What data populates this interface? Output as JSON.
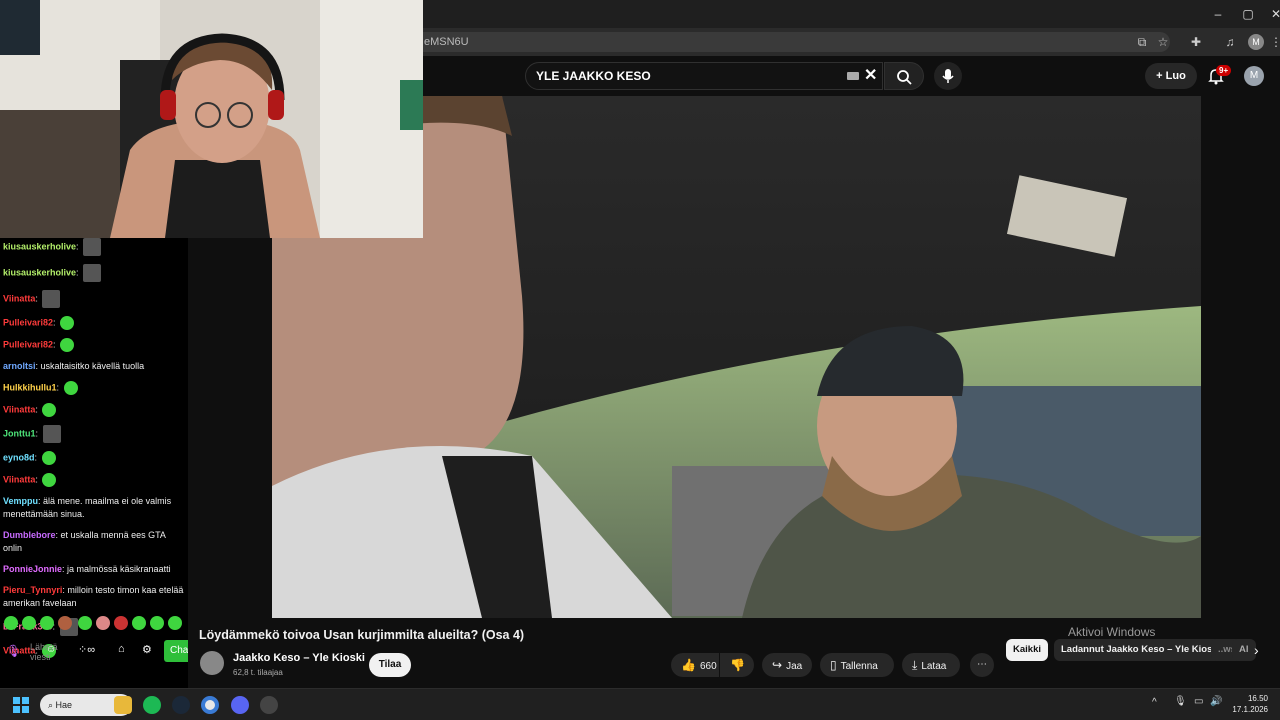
{
  "browser": {
    "url_fragment": "eMSN6U",
    "profile_initial": "M"
  },
  "youtube": {
    "search_value": "YLE JAAKKO KESO",
    "create_label": "Luo",
    "notification_badge": "9+",
    "avatar_initial": "M"
  },
  "video": {
    "title": "Löydämmekö toivoa Usan kurjimmilta alueilta? (Osa 4)",
    "channel": "Jaakko Keso – Yle Kioski",
    "subscribers": "62,8 t. tilaajaa",
    "subscribe_label": "Tilaa",
    "likes": "660",
    "share_label": "Jaa",
    "save_label": "Tallenna",
    "download_label": "Lataa"
  },
  "chips": [
    "Kaikki",
    "Ladannut Jaakko Keso – Yle Kioski",
    "..ws.",
    "Al"
  ],
  "windows_watermark": "Aktivoi Windows",
  "chat": {
    "messages": [
      {
        "user": "kiusauskerholive",
        "color": "#b4f06b",
        "text": "",
        "emote": "img"
      },
      {
        "user": "kiusauskerholive",
        "color": "#b4f06b",
        "text": "",
        "emote": "img"
      },
      {
        "user": "Viinatta",
        "color": "#ff3b3b",
        "text": "",
        "emote": "img"
      },
      {
        "user": "Pulleivari82",
        "color": "#ff3b3b",
        "text": "",
        "emote": "pepe"
      },
      {
        "user": "Pulleivari82",
        "color": "#ff3b3b",
        "text": "",
        "emote": "pepe"
      },
      {
        "user": "arnoltsi",
        "color": "#6fa8ff",
        "text": "uskaltaisitko kävellä tuolla",
        "emote": ""
      },
      {
        "user": "Hulkkihullu1",
        "color": "#ffd24a",
        "text": "",
        "emote": "pepe"
      },
      {
        "user": "Viinatta",
        "color": "#ff3b3b",
        "text": "",
        "emote": "pepe"
      },
      {
        "user": "Jonttu1",
        "color": "#4ee57a",
        "text": "",
        "emote": "img"
      },
      {
        "user": "eyno8d",
        "color": "#6fe0ff",
        "text": "",
        "emote": "pepe"
      },
      {
        "user": "Viinatta",
        "color": "#ff3b3b",
        "text": "",
        "emote": "pepe"
      },
      {
        "user": "Vemppu",
        "color": "#6fe0ff",
        "text": "älä mene. maailma ei ole valmis menettämään sinua.",
        "emote": ""
      },
      {
        "user": "Dumblebore",
        "color": "#c86bff",
        "text": "et uskalla mennä ees GTA onlin",
        "emote": ""
      },
      {
        "user": "PonnieJonnie",
        "color": "#e06bff",
        "text": "ja malmössä käsikranaatti",
        "emote": ""
      },
      {
        "user": "Pieru_Tynnyri",
        "color": "#ff3b3b",
        "text": "milloin testo timon kaa etelää amerikan favelaan",
        "emote": ""
      },
      {
        "user": "DrFrank360",
        "color": "#ff6b9a",
        "text": "",
        "emote": "img"
      },
      {
        "user": "Viinatta",
        "color": "#ff3b3b",
        "text": "",
        "emote": "pepe"
      }
    ],
    "input_placeholder": "Lähetä viesti",
    "chat_button": "Cha"
  },
  "taskbar": {
    "search_label": "Hae",
    "time": "16.50",
    "date": "17.1.2026"
  }
}
